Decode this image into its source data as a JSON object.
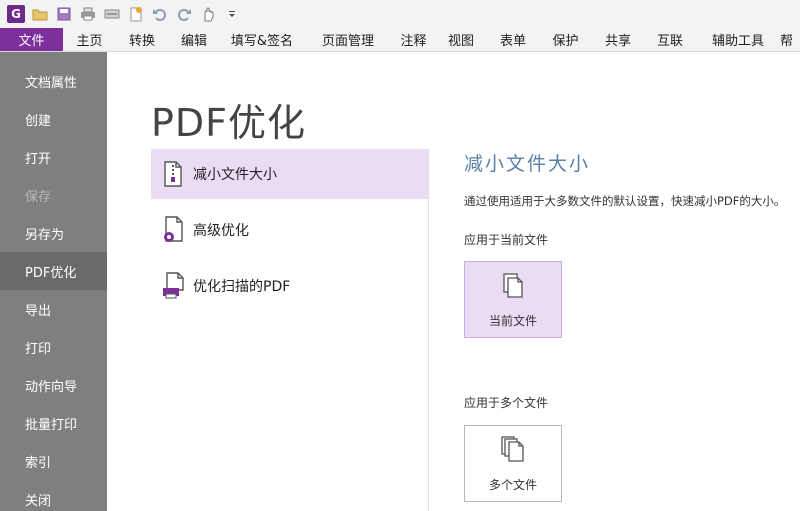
{
  "qat": {
    "app_logo": "G",
    "icons": [
      "open-folder-icon",
      "save-icon",
      "print-icon",
      "scan-icon",
      "new-icon",
      "undo-icon",
      "redo-icon",
      "hand-tool-icon",
      "customize-dropdown-icon"
    ]
  },
  "tabs": [
    {
      "label": "文件"
    },
    {
      "label": "主页"
    },
    {
      "label": "转换"
    },
    {
      "label": "编辑"
    },
    {
      "label": "填写&签名"
    },
    {
      "label": "页面管理"
    },
    {
      "label": "注释"
    },
    {
      "label": "视图"
    },
    {
      "label": "表单"
    },
    {
      "label": "保护"
    },
    {
      "label": "共享"
    },
    {
      "label": "互联"
    },
    {
      "label": "辅助工具"
    },
    {
      "label": "帮"
    }
  ],
  "leftnav": [
    {
      "label": "文档属性"
    },
    {
      "label": "创建"
    },
    {
      "label": "打开"
    },
    {
      "label": "保存"
    },
    {
      "label": "另存为"
    },
    {
      "label": "PDF优化"
    },
    {
      "label": "导出"
    },
    {
      "label": "打印"
    },
    {
      "label": "动作向导"
    },
    {
      "label": "批量打印"
    },
    {
      "label": "索引"
    },
    {
      "label": "关闭"
    }
  ],
  "main": {
    "title": "PDF优化",
    "options": [
      {
        "label": "减小文件大小"
      },
      {
        "label": "高级优化"
      },
      {
        "label": "优化扫描的PDF"
      }
    ],
    "detail": {
      "title": "减小文件大小",
      "description": "通过使用适用于大多数文件的默认设置，快速减小PDF的大小。",
      "current_section": "应用于当前文件",
      "current_button": "当前文件",
      "multi_section": "应用于多个文件",
      "multi_button": "多个文件"
    }
  },
  "colors": {
    "accent": "#7d2f9b",
    "selected_bg": "#eadcf5",
    "nav_bg": "#7f7f7f",
    "detail_title": "#5b7fa8"
  }
}
